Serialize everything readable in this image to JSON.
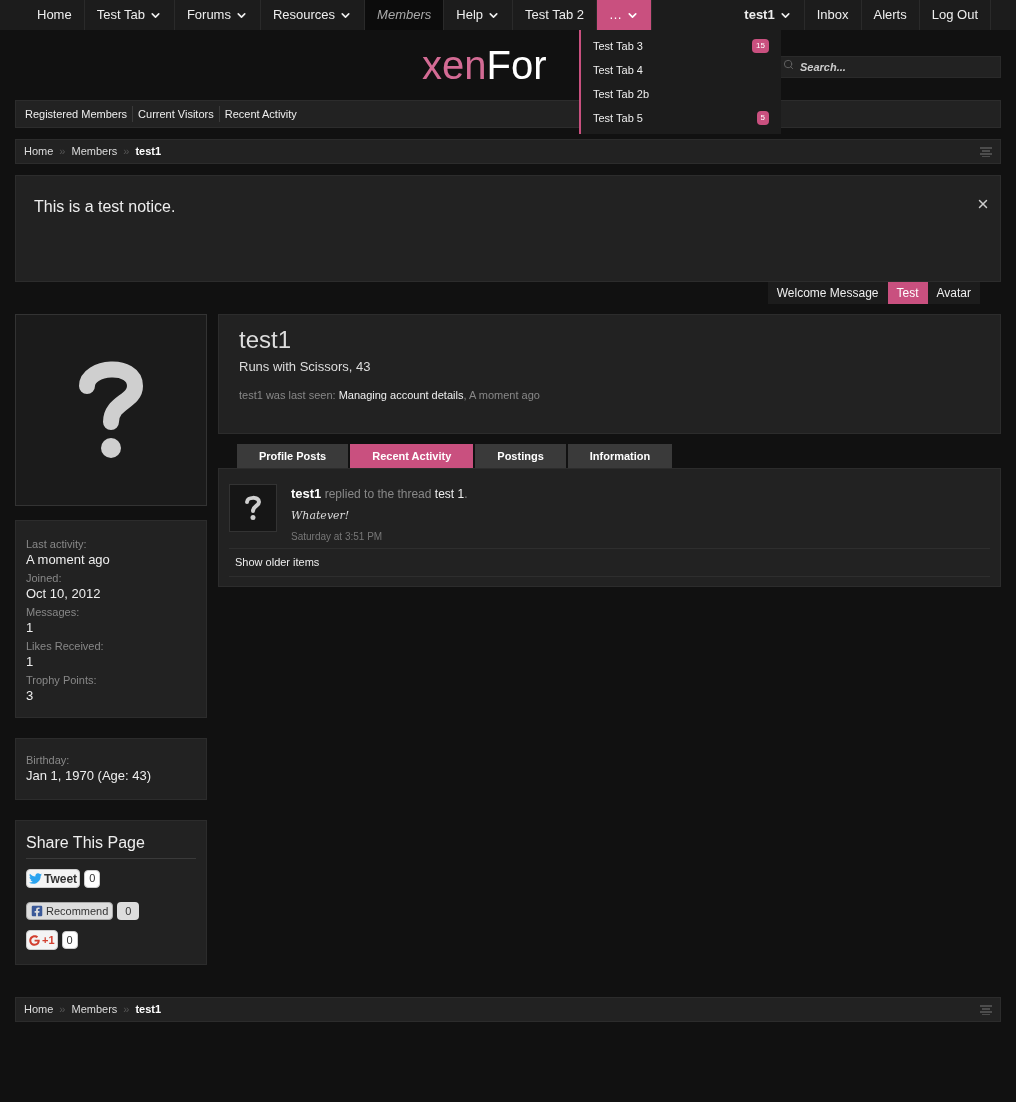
{
  "nav": {
    "left": [
      {
        "label": "Home",
        "has_menu": false,
        "selected": false,
        "open": false
      },
      {
        "label": "Test Tab",
        "has_menu": true,
        "selected": false,
        "open": false
      },
      {
        "label": "Forums",
        "has_menu": true,
        "selected": false,
        "open": false
      },
      {
        "label": "Resources",
        "has_menu": true,
        "selected": false,
        "open": false
      },
      {
        "label": "Members",
        "has_menu": false,
        "selected": true,
        "open": false
      },
      {
        "label": "Help",
        "has_menu": true,
        "selected": false,
        "open": false
      },
      {
        "label": "Test Tab 2",
        "has_menu": false,
        "selected": false,
        "open": false
      },
      {
        "label": "…",
        "has_menu": true,
        "selected": false,
        "open": true
      }
    ],
    "right": [
      {
        "label": "test1",
        "has_menu": true,
        "bold": true
      },
      {
        "label": "Inbox",
        "has_menu": false,
        "bold": false
      },
      {
        "label": "Alerts",
        "has_menu": false,
        "bold": false
      },
      {
        "label": "Log Out",
        "has_menu": false,
        "bold": false
      }
    ]
  },
  "dropdown": {
    "items": [
      {
        "label": "Test Tab 3",
        "badge": "15"
      },
      {
        "label": "Test Tab 4"
      },
      {
        "label": "Test Tab 2b"
      },
      {
        "label": "Test Tab 5",
        "badge": "5"
      }
    ]
  },
  "logo": {
    "first": "xen",
    "second": "For"
  },
  "search": {
    "placeholder": "Search..."
  },
  "subnav": {
    "items": [
      "Registered Members",
      "Current Visitors",
      "Recent Activity"
    ]
  },
  "breadcrumb": {
    "separator": "»",
    "items": [
      {
        "label": "Home",
        "current": false
      },
      {
        "label": "Members",
        "current": false
      },
      {
        "label": "test1",
        "current": true
      }
    ]
  },
  "notice": {
    "text": "This is a test notice."
  },
  "notice_tabs": [
    {
      "label": "Welcome Message",
      "selected": false
    },
    {
      "label": "Test",
      "selected": true
    },
    {
      "label": "Avatar",
      "selected": false
    }
  ],
  "profile": {
    "name": "test1",
    "title": "Runs with Scissors, 43",
    "last_seen_label": "test1 was last seen:",
    "last_seen_activity": "Managing account details",
    "last_seen_sep": ",",
    "last_seen_time": "A moment ago"
  },
  "profile_tabs": [
    {
      "label": "Profile Posts",
      "selected": false
    },
    {
      "label": "Recent Activity",
      "selected": true
    },
    {
      "label": "Postings",
      "selected": false
    },
    {
      "label": "Information",
      "selected": false
    }
  ],
  "activity": {
    "user": "test1",
    "action": "replied to the thread",
    "thread": "test 1",
    "end": ".",
    "quote": "Whatever!",
    "time": "Saturday at 3:51 PM",
    "show_older": "Show older items"
  },
  "stats": [
    {
      "label": "Last activity:",
      "value": "A moment ago"
    },
    {
      "label": "Joined:",
      "value": "Oct 10, 2012"
    },
    {
      "label": "Messages:",
      "value": "1"
    },
    {
      "label": "Likes Received:",
      "value": "1"
    },
    {
      "label": "Trophy Points:",
      "value": "3"
    }
  ],
  "birthday": {
    "label": "Birthday:",
    "value": "Jan 1, 1970 (Age: 43)"
  },
  "share": {
    "title": "Share This Page",
    "buttons": [
      {
        "kind": "tweet",
        "label": "Tweet",
        "count": "0"
      },
      {
        "kind": "recommend",
        "label": "Recommend",
        "count": "0"
      },
      {
        "kind": "plusone",
        "label": "+1",
        "count": "0"
      }
    ]
  },
  "footer_breadcrumb": {
    "separator": "»",
    "items": [
      {
        "label": "Home",
        "current": false
      },
      {
        "label": "Members",
        "current": false
      },
      {
        "label": "test1",
        "current": true
      }
    ]
  }
}
